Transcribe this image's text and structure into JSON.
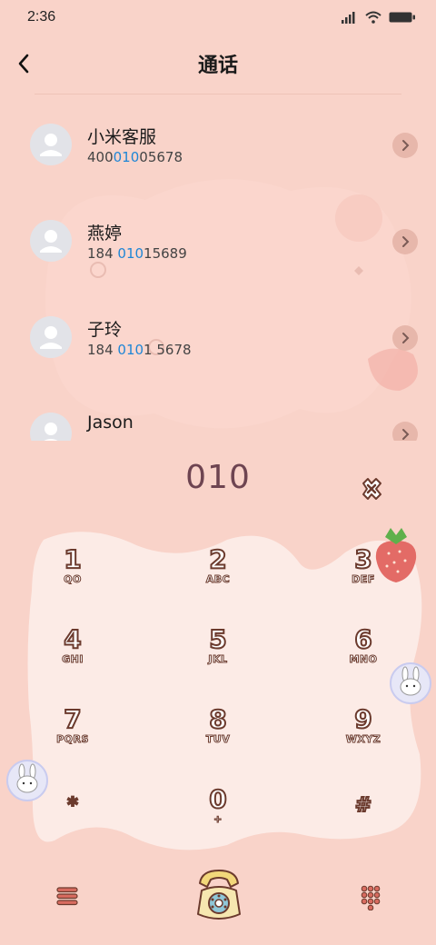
{
  "status": {
    "time": "2:36"
  },
  "header": {
    "title": "通话"
  },
  "contacts": [
    {
      "name": "小米客服",
      "num_pre": "400",
      "num_hl": "010",
      "num_post": "05678"
    },
    {
      "name": "燕婷",
      "num_pre": "184 ",
      "num_hl": "010",
      "num_post": "15689"
    },
    {
      "name": "子玲",
      "num_pre": "184 ",
      "num_hl": "010",
      "num_post": "1 5678"
    },
    {
      "name": "Jason",
      "num_pre": "",
      "num_hl": "",
      "num_post": ""
    }
  ],
  "dialer": {
    "input": "010",
    "keys": [
      {
        "digit": "1",
        "letters": "QO"
      },
      {
        "digit": "2",
        "letters": "ABC"
      },
      {
        "digit": "3",
        "letters": "DEF"
      },
      {
        "digit": "4",
        "letters": "GHI"
      },
      {
        "digit": "5",
        "letters": "JKL"
      },
      {
        "digit": "6",
        "letters": "MNO"
      },
      {
        "digit": "7",
        "letters": "PQRS"
      },
      {
        "digit": "8",
        "letters": "TUV"
      },
      {
        "digit": "9",
        "letters": "WXYZ"
      },
      {
        "digit": "*",
        "letters": ""
      },
      {
        "digit": "0",
        "letters": "+"
      },
      {
        "digit": "#",
        "letters": ""
      }
    ]
  },
  "icons": {
    "back": "chevron-left-icon",
    "delete": "delete-icon",
    "menu": "menu-icon",
    "call": "telephone-icon",
    "keypad": "dialpad-icon"
  },
  "colors": {
    "background": "#f9d3c9",
    "keypad_panel": "#fcebe6",
    "highlight": "#1f86d6",
    "input_text": "#6e4451"
  }
}
